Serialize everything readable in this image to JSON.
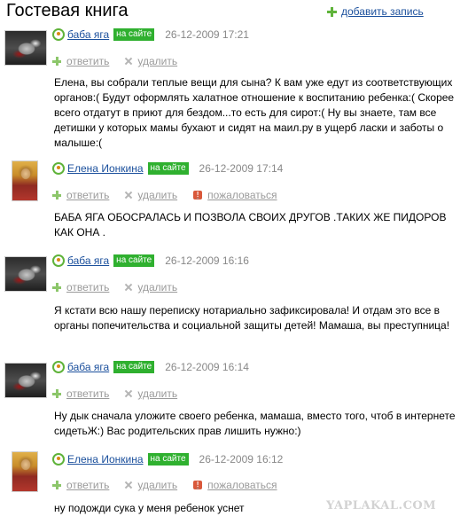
{
  "page": {
    "title": "Гостевая книга",
    "add_entry": "добавить запись"
  },
  "labels": {
    "online": "на сайте",
    "reply": "ответить",
    "delete": "удалить",
    "report": "пожаловаться"
  },
  "comments": [
    {
      "user": "баба яга",
      "date": "26-12-2009 17:21",
      "text": "Елена, вы собрали теплые вещи для сына? К вам уже едут из соответствующих органов:( Будут оформлять халатное отношение к воспитанию ребенка:( Скорее всего отдатут в приют для бездом...то есть для сирот:( Ну вы знаете, там все детишки у которых мамы бухают и сидят на маил.ру в ущерб ласки и заботы о малыше:("
    },
    {
      "user": "Елена Ионкина",
      "date": "26-12-2009 17:14",
      "text": "БАБА ЯГА ОБОСРАЛАСЬ И ПОЗВОЛА СВОИХ ДРУГОВ .ТАКИХ ЖЕ ПИДОРОВ КАК ОНА ."
    },
    {
      "user": "баба яга",
      "date": "26-12-2009 16:16",
      "text": "Я кстати всю нашу переписку нотариально зафиксировала! И отдам это все в органы попечительства и социальной защиты детей! Мамаша, вы преступница!"
    },
    {
      "user": "баба яга",
      "date": "26-12-2009 16:14",
      "text": "Ну дык сначала уложите своего ребенка, мамаша, вместо того, чтоб в интернете сидетьЖ:) Вас родительских прав лишить нужно:)"
    },
    {
      "user": "Елена Ионкина",
      "date": "26-12-2009 16:12",
      "text": "ну подожди сука у меня ребенок уснет"
    }
  ],
  "watermark": "YAPLAKAL.COM"
}
